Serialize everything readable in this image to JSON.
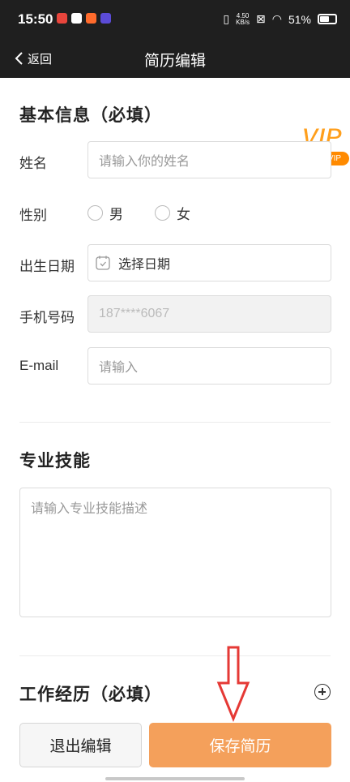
{
  "status_bar": {
    "time": "15:50",
    "net_speed_top": "4.50",
    "net_speed_bottom": "KB/s",
    "battery": "51%"
  },
  "nav": {
    "back_label": "返回",
    "title": "简历编辑"
  },
  "basic_info": {
    "title": "基本信息（必填）",
    "name_label": "姓名",
    "name_placeholder": "请输入你的姓名",
    "gender_label": "性别",
    "gender_male": "男",
    "gender_female": "女",
    "birth_label": "出生日期",
    "birth_placeholder": "选择日期",
    "phone_label": "手机号码",
    "phone_value": "187****6067",
    "email_label": "E-mail",
    "email_placeholder": "请输入"
  },
  "vip": {
    "text": "VIP",
    "badge": "免费领VIP"
  },
  "skills": {
    "title": "专业技能",
    "placeholder": "请输入专业技能描述"
  },
  "work": {
    "title": "工作经历（必填）"
  },
  "buttons": {
    "exit": "退出编辑",
    "save": "保存简历"
  },
  "colors": {
    "header_bg": "#1f1f1f",
    "save_button": "#f4a05b",
    "annotation_arrow": "#e53935",
    "vip_orange": "#ff8a00"
  }
}
